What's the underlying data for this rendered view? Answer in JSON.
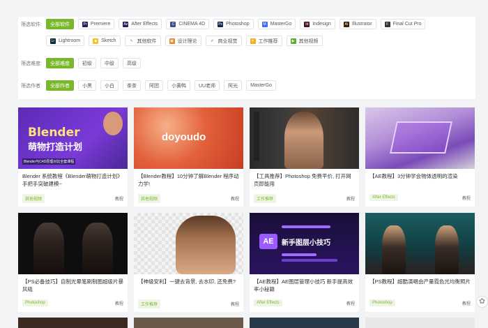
{
  "filters": [
    {
      "label": "筛选软件:",
      "items": [
        {
          "label": "全部软件",
          "active": true
        },
        {
          "label": "Premiere",
          "icon": "premiere-icon",
          "color": "#2a1a5e"
        },
        {
          "label": "After Effects",
          "icon": "after-effects-icon",
          "color": "#2a1a5e"
        },
        {
          "label": "CINEMA 4D",
          "icon": "cinema4d-icon",
          "color": "#3d4f8f"
        },
        {
          "label": "Photoshop",
          "icon": "photoshop-icon",
          "color": "#0d2a4a"
        },
        {
          "label": "MasterGo",
          "icon": "mastergo-icon",
          "color": "#3f6bf2"
        },
        {
          "label": "Indesign",
          "icon": "indesign-icon",
          "color": "#4a0f2a"
        },
        {
          "label": "Illustrator",
          "icon": "illustrator-icon",
          "color": "#3a1f00"
        },
        {
          "label": "Final Cut Pro",
          "icon": "final-cut-pro-icon",
          "color": "#333333"
        }
      ]
    },
    {
      "label": "",
      "items": [
        {
          "label": "Lightroom",
          "icon": "lightroom-icon",
          "color": "#0c2b3a"
        },
        {
          "label": "Sketch",
          "icon": "sketch-icon",
          "color": "#f5c02a"
        },
        {
          "label": "其他软件",
          "icon": "other-software-icon",
          "color": "#888888"
        },
        {
          "label": "设计理论",
          "icon": "design-theory-icon",
          "color": "#e38a2c"
        },
        {
          "label": "商业视觉",
          "icon": "commercial-visual-icon",
          "color": "#888888"
        },
        {
          "label": "工作推荐",
          "icon": "work-recommend-icon",
          "color": "#f0b020"
        },
        {
          "label": "其他视频",
          "icon": "other-video-icon",
          "color": "#5ab030"
        }
      ]
    },
    {
      "label": "筛选难度:",
      "items": [
        {
          "label": "全部难度",
          "active": true
        },
        {
          "label": "初级"
        },
        {
          "label": "中级"
        },
        {
          "label": "高级"
        }
      ]
    },
    {
      "label": "筛选作者:",
      "items": [
        {
          "label": "全部作者",
          "active": true
        },
        {
          "label": "小黑"
        },
        {
          "label": "小白"
        },
        {
          "label": "茶茶"
        },
        {
          "label": "阿团"
        },
        {
          "label": "小黄鸭"
        },
        {
          "label": "UU老师"
        },
        {
          "label": "阿光"
        },
        {
          "label": "MasterGo"
        }
      ]
    }
  ],
  "cards": [
    {
      "title": "Blender 系统教程《Blender萌物打造计划》手把手突破建模~",
      "category": "其他视频",
      "type": "教程",
      "thumb_text": [
        "Blender",
        "萌物打造计划",
        "Blender与C4D原理对比全套课程"
      ]
    },
    {
      "title": "【Blender教程】10分钟了解Blender 程序动力学!",
      "category": "其他视频",
      "type": "教程",
      "thumb_text": [
        "doyoudo"
      ]
    },
    {
      "title": "【工具推荐】Photoshop 免费平价, 打开网页即能用",
      "category": "工作推荐",
      "type": "教程",
      "thumb_text": []
    },
    {
      "title": "【AE教程】3分钟学会物体透明的渲染",
      "category": "After Effects",
      "type": "教程",
      "thumb_text": []
    },
    {
      "title": "【PS必备技巧】自制光晕笔刷制图超级片暴风吸",
      "category": "Photoshop",
      "type": "教程",
      "thumb_text": []
    },
    {
      "title": "【神级安利】一键去背景, 去水印, 还免费?",
      "category": "工作推荐",
      "type": "教程",
      "thumb_text": []
    },
    {
      "title": "【AE教程】AE图层管理小技巧 新手提高效率小秘籍",
      "category": "After Effects",
      "type": "教程",
      "thumb_text": [
        "AE",
        "新手图层小技巧"
      ]
    },
    {
      "title": "【PS教程】超酷演唱会产量霓色光均衡照片",
      "category": "Photoshop",
      "type": "教程",
      "thumb_text": []
    }
  ],
  "float_button_icon": "customer-service-icon"
}
